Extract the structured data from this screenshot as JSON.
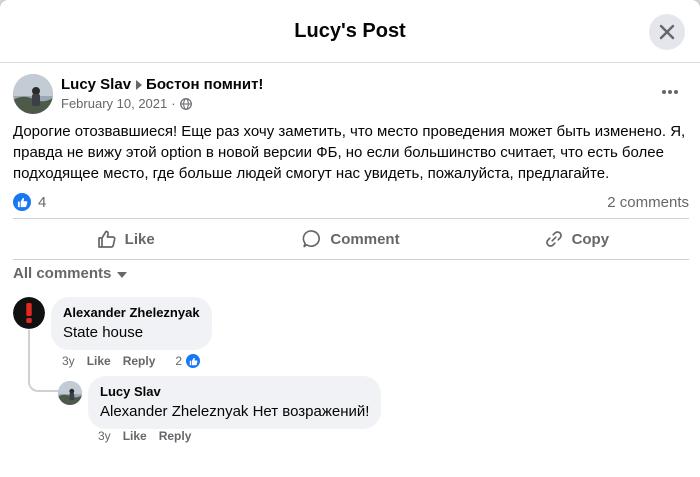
{
  "dialog": {
    "title": "Lucy's Post"
  },
  "post": {
    "author": "Lucy Slav",
    "group": "Бостон помнит!",
    "date": "February 10, 2021",
    "separator": "·",
    "privacy_icon": "globe-icon",
    "text": "Дорогие отозвавшиеся! Еще раз хочу заметить, что место проведения может быть изменено. Я, правда не вижу этой option в новой версии ФБ, но если большинство считает, что есть более подходящее место, где больше людей смогут нас увидеть, пожалуйста, предлагайте.",
    "like_count": "4",
    "comments_count": "2 comments"
  },
  "actions": {
    "like": "Like",
    "comment": "Comment",
    "copy": "Copy"
  },
  "filter": {
    "label": "All comments"
  },
  "comments": [
    {
      "author": "Alexander Zheleznyak",
      "text": "State house",
      "time": "3y",
      "like": "Like",
      "reply": "Reply",
      "reactions": "2"
    },
    {
      "author": "Lucy Slav",
      "text": "Alexander Zheleznyak Нет возражений!",
      "time": "3y",
      "like": "Like",
      "reply": "Reply"
    }
  ],
  "colors": {
    "accent": "#1877f2",
    "secondary_text": "#65676b",
    "bubble": "#f0f2f5"
  }
}
